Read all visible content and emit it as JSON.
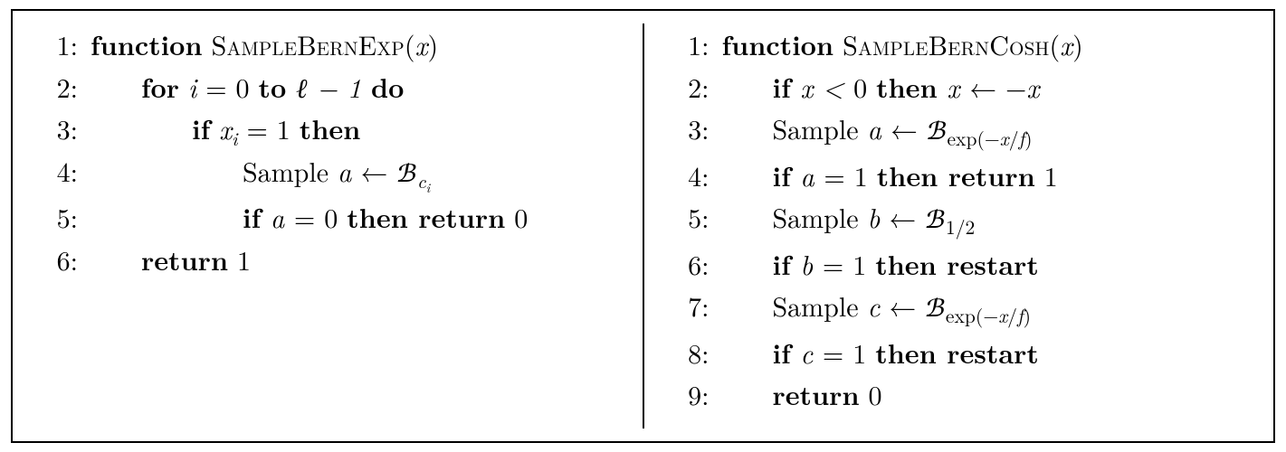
{
  "left": {
    "func_kw": "function",
    "func_name": "SampleBernExp",
    "arg": "x",
    "l2_for": "for",
    "l2_eq": " = 0 ",
    "l2_to": "to",
    "l2_ell": " ℓ − 1 ",
    "l2_do": "do",
    "l3_if": "if",
    "l3_eq": " = 1 ",
    "l3_then": "then",
    "l4_sample": "Sample ",
    "l4_a": "a",
    "l4_arrow": " ← ",
    "l4_B": "ℬ",
    "l5_if": "if",
    "l5_a": " a ",
    "l5_eq": "= 0 ",
    "l5_then": "then return",
    "l5_zero": " 0",
    "l6_return": "return",
    "l6_one": " 1",
    "nums": [
      "1:",
      "2:",
      "3:",
      "4:",
      "5:",
      "6:"
    ]
  },
  "right": {
    "func_kw": "function",
    "func_name": "SampleBernCosh",
    "arg": "x",
    "l2_if": "if",
    "l2_xlt": " x < ",
    "l2_zero": "0 ",
    "l2_then": "then",
    "l2_assign_x": " x ",
    "l2_arrow": "← −",
    "l2_x2": "x",
    "l3_sample": "Sample ",
    "l3_a": "a",
    "l3_arrow": " ← ",
    "l3_B": "ℬ",
    "l3_sub": "exp(−x/f)",
    "l4_if": "if",
    "l4_a": " a ",
    "l4_eq": "= 1 ",
    "l4_then": "then return",
    "l4_one": " 1",
    "l5_sample": "Sample ",
    "l5_b": "b",
    "l5_arrow": " ← ",
    "l5_B": "ℬ",
    "l5_sub": "1/2",
    "l6_if": "if",
    "l6_b": " b ",
    "l6_eq": "= 1 ",
    "l6_then": "then restart",
    "l7_sample": "Sample ",
    "l7_c": "c",
    "l7_arrow": " ← ",
    "l7_B": "ℬ",
    "l7_sub": "exp(−x/f)",
    "l8_if": "if",
    "l8_c": " c ",
    "l8_eq": "= 1 ",
    "l8_then": "then restart",
    "l9_return": "return",
    "l9_zero": " 0",
    "nums": [
      "1:",
      "2:",
      "3:",
      "4:",
      "5:",
      "6:",
      "7:",
      "8:",
      "9:"
    ]
  }
}
